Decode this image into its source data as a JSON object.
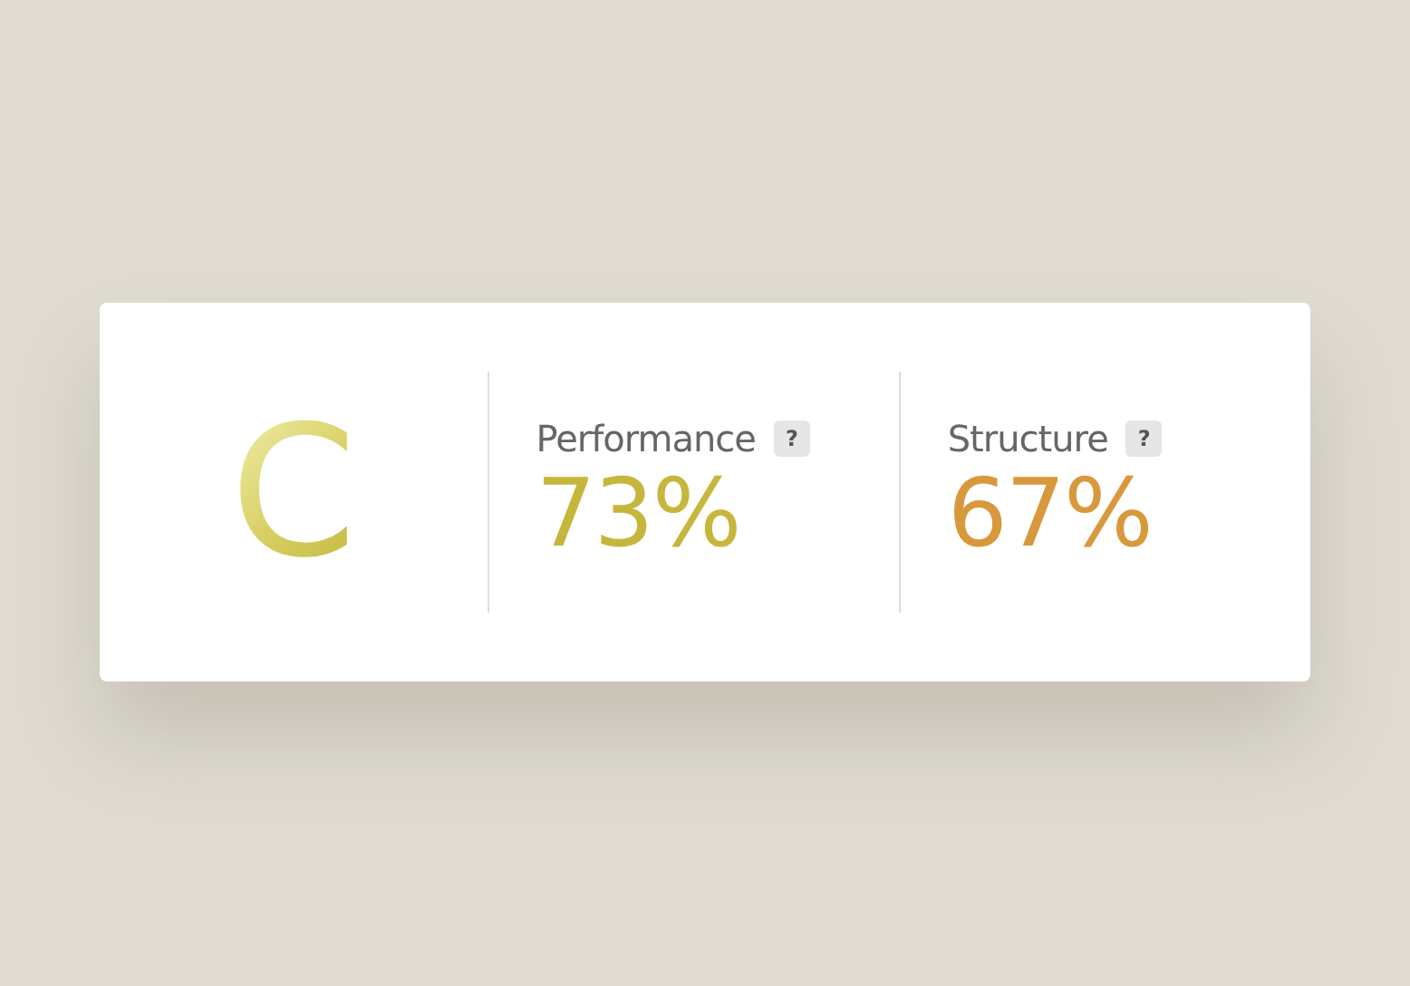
{
  "grade": "C",
  "metrics": [
    {
      "label": "Performance",
      "help": "?",
      "value": "73%",
      "color": "#c6b63c"
    },
    {
      "label": "Structure",
      "help": "?",
      "value": "67%",
      "color": "#d8983c"
    }
  ]
}
